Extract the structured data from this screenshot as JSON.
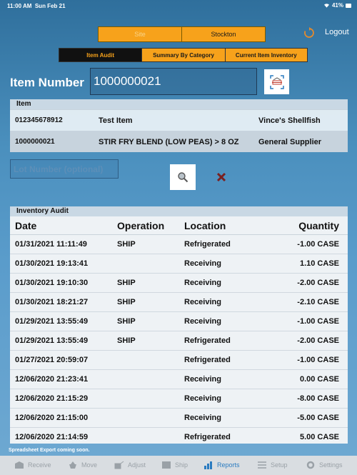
{
  "status_bar": {
    "time": "11:00 AM",
    "date": "Sun Feb 21",
    "battery": "41%"
  },
  "header": {
    "site_label": "Site",
    "site_value": "Stockton",
    "logout_label": "Logout"
  },
  "tabs": [
    {
      "label": "Item Audit",
      "active": true
    },
    {
      "label": "Summary By Category",
      "active": false
    },
    {
      "label": "Current Item Inventory",
      "active": false
    }
  ],
  "item_number": {
    "label": "Item Number",
    "value": "1000000021"
  },
  "item_table": {
    "header": "Item",
    "rows": [
      {
        "code": "012345678912",
        "name": "Test Item",
        "supplier": "Vince's Shellfish"
      },
      {
        "code": "1000000021",
        "name": "STIR FRY BLEND (LOW PEAS) > 8 OZ",
        "supplier": "General Supplier"
      }
    ]
  },
  "lot_number": {
    "placeholder": "Lot Number (optional)"
  },
  "audit": {
    "title": "Inventory Audit",
    "columns": [
      "Date",
      "Operation",
      "Location",
      "Quantity"
    ],
    "rows": [
      {
        "date": "01/31/2021 11:11:49",
        "operation": "SHIP",
        "location": "Refrigerated",
        "quantity": "-1.00 CASE"
      },
      {
        "date": "01/30/2021 19:13:41",
        "operation": "",
        "location": "Receiving",
        "quantity": "1.10 CASE"
      },
      {
        "date": "01/30/2021 19:10:30",
        "operation": "SHIP",
        "location": "Receiving",
        "quantity": "-2.00 CASE"
      },
      {
        "date": "01/30/2021 18:21:27",
        "operation": "SHIP",
        "location": "Receiving",
        "quantity": "-2.10 CASE"
      },
      {
        "date": "01/29/2021 13:55:49",
        "operation": "SHIP",
        "location": "Receiving",
        "quantity": "-1.00 CASE"
      },
      {
        "date": "01/29/2021 13:55:49",
        "operation": "SHIP",
        "location": "Refrigerated",
        "quantity": "-2.00 CASE"
      },
      {
        "date": "01/27/2021 20:59:07",
        "operation": "",
        "location": "Refrigerated",
        "quantity": "-1.00 CASE"
      },
      {
        "date": "12/06/2020 21:23:41",
        "operation": "",
        "location": "Receiving",
        "quantity": "0.00 CASE"
      },
      {
        "date": "12/06/2020 21:15:29",
        "operation": "",
        "location": "Receiving",
        "quantity": "-8.00 CASE"
      },
      {
        "date": "12/06/2020 21:15:00",
        "operation": "",
        "location": "Receiving",
        "quantity": "-5.00 CASE"
      },
      {
        "date": "12/06/2020 21:14:59",
        "operation": "",
        "location": "Refrigerated",
        "quantity": "5.00 CASE"
      }
    ]
  },
  "export_note": "Spreadsheet Export coming soon.",
  "tabbar": [
    {
      "label": "Receive",
      "icon": "receive-icon",
      "active": false
    },
    {
      "label": "Move",
      "icon": "move-icon",
      "active": false
    },
    {
      "label": "Adjust",
      "icon": "adjust-icon",
      "active": false
    },
    {
      "label": "Ship",
      "icon": "ship-icon",
      "active": false
    },
    {
      "label": "Reports",
      "icon": "reports-icon",
      "active": true
    },
    {
      "label": "Setup",
      "icon": "setup-icon",
      "active": false
    },
    {
      "label": "Settings",
      "icon": "settings-icon",
      "active": false
    }
  ],
  "colors": {
    "accent_orange": "#f7a21b",
    "active_tab": "#2a7bc0",
    "background": "#4a8fbd"
  }
}
